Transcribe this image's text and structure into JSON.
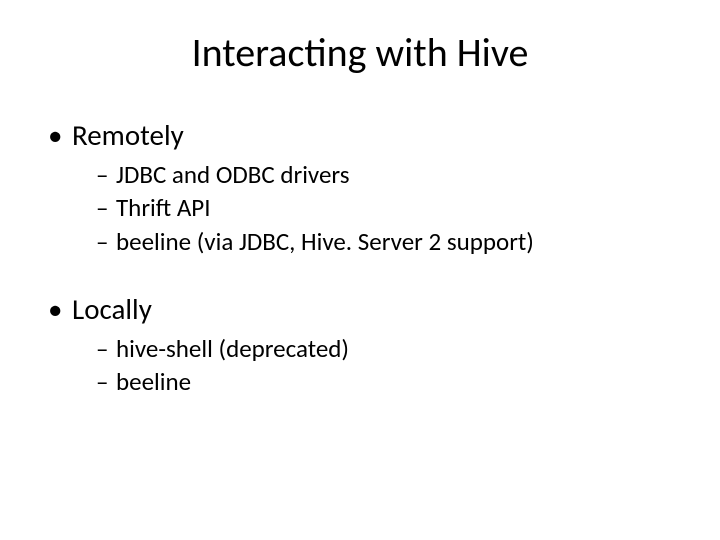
{
  "title": "Interacting with Hive",
  "sections": [
    {
      "heading": "Remotely",
      "items": [
        "JDBC and ODBC drivers",
        "Thrift API",
        "beeline (via JDBC, Hive. Server 2 support)"
      ]
    },
    {
      "heading": "Locally",
      "items": [
        "hive-shell (deprecated)",
        "beeline"
      ]
    }
  ]
}
